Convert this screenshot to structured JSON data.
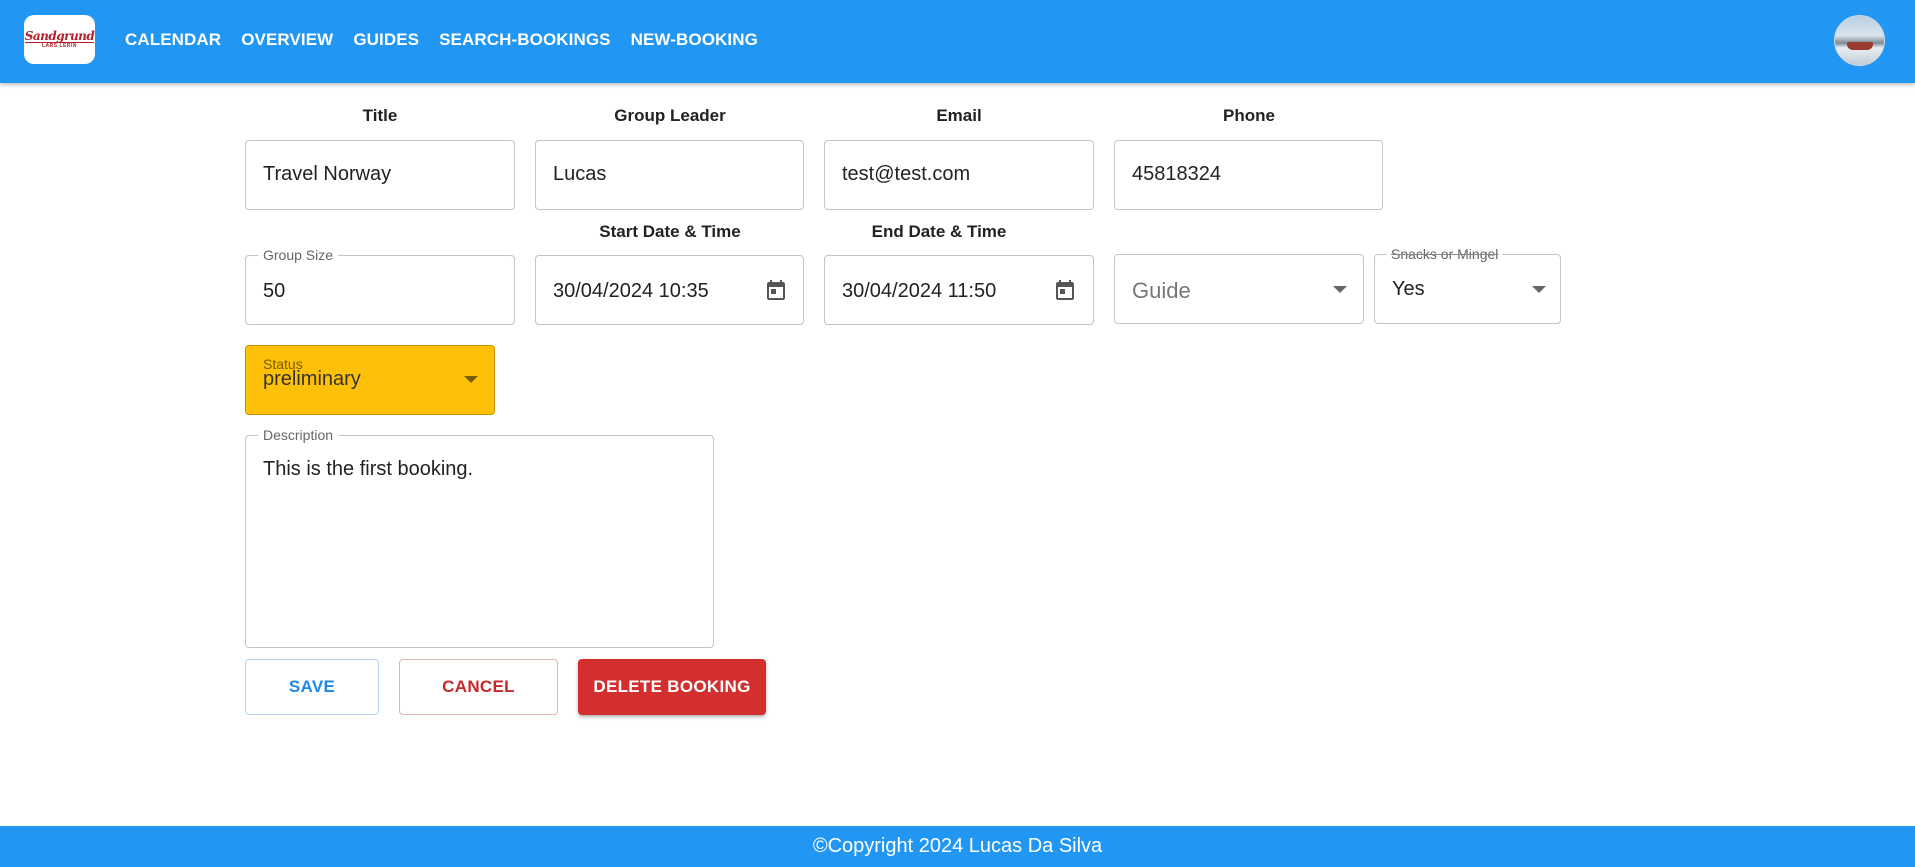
{
  "header": {
    "logo_line1": "Sandgrund",
    "logo_line2": "LARS LERIN",
    "nav": [
      "CALENDAR",
      "OVERVIEW",
      "GUIDES",
      "SEARCH-BOOKINGS",
      "NEW-BOOKING"
    ]
  },
  "form": {
    "title": {
      "label": "Title",
      "value": "Travel Norway"
    },
    "group_leader": {
      "label": "Group Leader",
      "value": "Lucas"
    },
    "email": {
      "label": "Email",
      "value": "test@test.com"
    },
    "phone": {
      "label": "Phone",
      "value": "45818324"
    },
    "group_size": {
      "label": "Group Size",
      "value": "50"
    },
    "start": {
      "label": "Start Date & Time",
      "value": "30/04/2024 10:35"
    },
    "end": {
      "label": "End Date & Time",
      "value": "30/04/2024 11:50"
    },
    "guide": {
      "placeholder": "Guide"
    },
    "snacks": {
      "label": "Snacks or Mingel",
      "value": "Yes"
    },
    "status": {
      "label": "Status",
      "value": "preliminary",
      "color": "#ffc107"
    },
    "description": {
      "label": "Description",
      "value": "This is the first booking."
    }
  },
  "buttons": {
    "save": "SAVE",
    "cancel": "CANCEL",
    "delete": "DELETE BOOKING"
  },
  "colors": {
    "primary": "#2196f3",
    "save_text": "#1e88e5",
    "cancel_text": "#c62828",
    "delete_bg": "#d32f2f"
  },
  "footer": {
    "text": "©Copyright 2024 Lucas Da Silva"
  }
}
